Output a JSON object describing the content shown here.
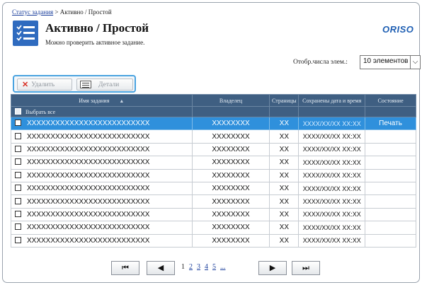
{
  "breadcrumb": {
    "root": "Статус задания",
    "sep": " > ",
    "current": "Активно / Простой"
  },
  "header": {
    "title": "Активно / Простой",
    "subtitle": "Можно проверить активное задание.",
    "brand": "ORISO",
    "icon": "list-check-icon"
  },
  "per_page": {
    "label": "Отобр.числа элем.:",
    "value": "10 элементов"
  },
  "toolbar": {
    "delete_label": "Удалить",
    "detail_label": "Детали"
  },
  "table": {
    "columns": [
      "Имя задания",
      "Владелец",
      "Страницы",
      "Сохранены дата и время",
      "Состояние"
    ],
    "select_all": "Выбрать все",
    "rows": [
      {
        "name": "XXXXXXXXXXXXXXXXXXXXXXXXXX",
        "owner": "XXXXXXXX",
        "pages": "XX",
        "date": "XXXX/XX/XX XX:XX",
        "state": "Печать",
        "selected": true
      },
      {
        "name": "XXXXXXXXXXXXXXXXXXXXXXXXXX",
        "owner": "XXXXXXXX",
        "pages": "XX",
        "date": "XXXX/XX/XX XX:XX",
        "state": ""
      },
      {
        "name": "XXXXXXXXXXXXXXXXXXXXXXXXXX",
        "owner": "XXXXXXXX",
        "pages": "XX",
        "date": "XXXX/XX/XX XX:XX",
        "state": ""
      },
      {
        "name": "XXXXXXXXXXXXXXXXXXXXXXXXXX",
        "owner": "XXXXXXXX",
        "pages": "XX",
        "date": "XXXX/XX/XX XX:XX",
        "state": ""
      },
      {
        "name": "XXXXXXXXXXXXXXXXXXXXXXXXXX",
        "owner": "XXXXXXXX",
        "pages": "XX",
        "date": "XXXX/XX/XX XX:XX",
        "state": ""
      },
      {
        "name": "XXXXXXXXXXXXXXXXXXXXXXXXXX",
        "owner": "XXXXXXXX",
        "pages": "XX",
        "date": "XXXX/XX/XX XX:XX",
        "state": ""
      },
      {
        "name": "XXXXXXXXXXXXXXXXXXXXXXXXXX",
        "owner": "XXXXXXXX",
        "pages": "XX",
        "date": "XXXX/XX/XX XX:XX",
        "state": ""
      },
      {
        "name": "XXXXXXXXXXXXXXXXXXXXXXXXXX",
        "owner": "XXXXXXXX",
        "pages": "XX",
        "date": "XXXX/XX/XX XX:XX",
        "state": ""
      },
      {
        "name": "XXXXXXXXXXXXXXXXXXXXXXXXXX",
        "owner": "XXXXXXXX",
        "pages": "XX",
        "date": "XXXX/XX/XX XX:XX",
        "state": ""
      },
      {
        "name": "XXXXXXXXXXXXXXXXXXXXXXXXXX",
        "owner": "XXXXXXXX",
        "pages": "XX",
        "date": "XXXX/XX/XX XX:XX",
        "state": ""
      }
    ]
  },
  "pager": {
    "first": "⏮",
    "prev": "◀",
    "next": "▶",
    "last": "⏭",
    "current": "1",
    "pages": [
      "2",
      "3",
      "4",
      "5"
    ],
    "more": "..."
  },
  "colors": {
    "header_bg": "#3f5f82",
    "selected_row": "#2f90dc",
    "toolbar_border": "#4aa3e0",
    "brand": "#1f5fb3"
  }
}
